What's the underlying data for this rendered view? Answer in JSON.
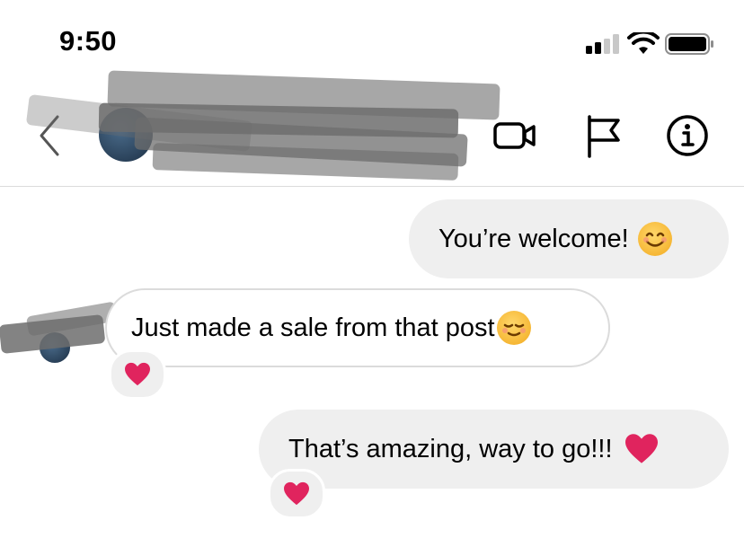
{
  "status_bar": {
    "time": "9:50",
    "signal_icon": "cellular-signal-icon",
    "wifi_icon": "wifi-icon",
    "battery_icon": "battery-icon"
  },
  "header": {
    "back_icon": "chevron-left-icon",
    "contact_name": "",
    "video_call_icon": "video-camera-icon",
    "flag_icon": "flag-icon",
    "info_icon": "info-icon"
  },
  "messages": [
    {
      "direction": "sent",
      "text": "You’re welcome!",
      "emoji": "smiling-face-icon"
    },
    {
      "direction": "received",
      "text": "Just made a sale from that post",
      "emoji": "relieved-face-icon",
      "reaction": "red-heart-icon"
    },
    {
      "direction": "sent",
      "text": "That’s amazing, way to go!!!",
      "emoji": "red-heart-icon",
      "reaction": "red-heart-icon"
    }
  ],
  "colors": {
    "sent_bubble": "#efefef",
    "received_border": "#dbdbdb",
    "heart": "#e0245e",
    "text": "#000000"
  }
}
